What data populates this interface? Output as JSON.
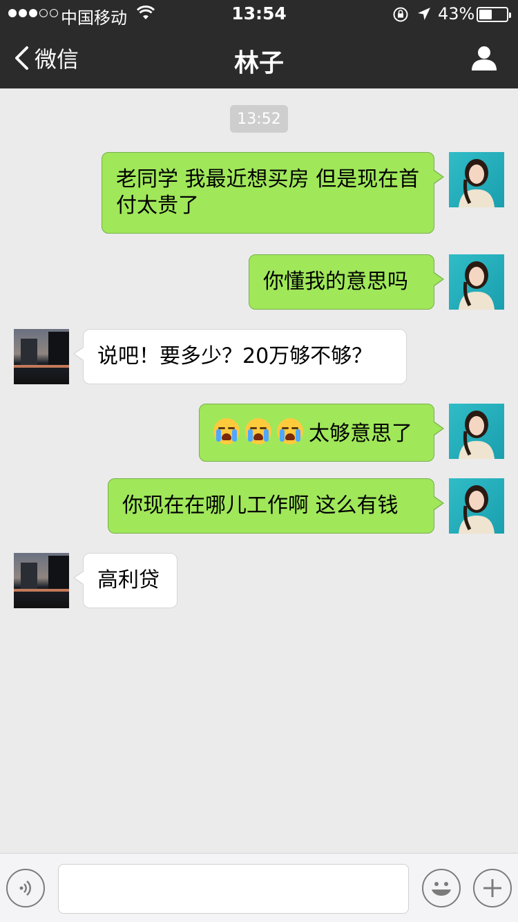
{
  "status_bar": {
    "carrier": "中国移动",
    "time": "13:54",
    "battery_percent": "43%"
  },
  "nav": {
    "back_label": "微信",
    "title": "林子"
  },
  "chat": {
    "timestamp": "13:52",
    "messages": [
      {
        "sender": "me",
        "text": "老同学 我最近想买房 但是现在首付太贵了"
      },
      {
        "sender": "me",
        "text": "你懂我的意思吗"
      },
      {
        "sender": "other",
        "text": "说吧！要多少？20万够不够？"
      },
      {
        "sender": "me",
        "emoji_count": 3,
        "emoji": "loudly-crying-face",
        "text": "太够意思了"
      },
      {
        "sender": "me",
        "text": "你现在在哪儿工作啊 这么有钱"
      },
      {
        "sender": "other",
        "text": "高利贷"
      }
    ]
  },
  "input_bar": {
    "text_value": ""
  },
  "colors": {
    "nav_bg": "#2b2b2c",
    "chat_bg": "#ebebeb",
    "my_bubble": "#a0e75a",
    "other_bubble": "#ffffff"
  }
}
